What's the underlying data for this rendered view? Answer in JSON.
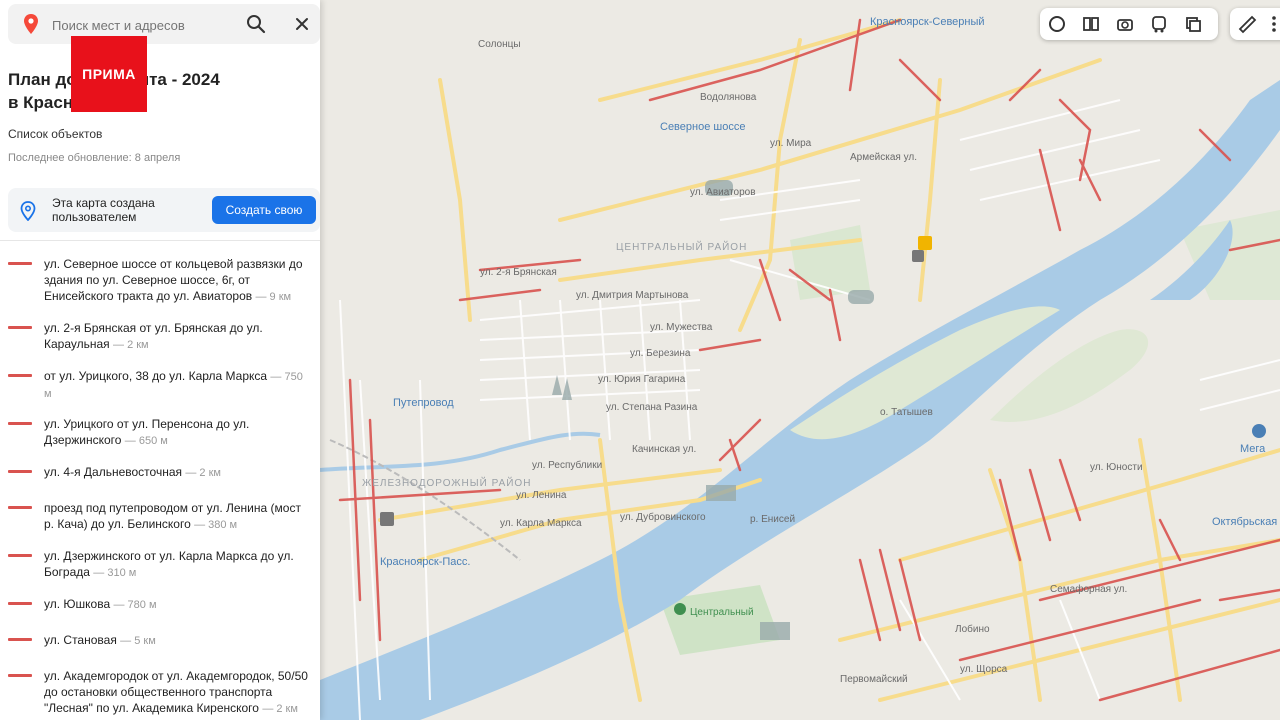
{
  "search": {
    "placeholder": "Поиск мест и адресов"
  },
  "logo": {
    "text": "ПРИМА"
  },
  "panel": {
    "title": "План дорожного ремонта - 2024 в Красноярске",
    "title_visible": "План до            о ремонта - 2024\nв Красн",
    "objects_link": "Список объектов",
    "updated": "Последнее обновление: 8 апреля",
    "promo_text": "Эта карта создана пользователем",
    "promo_button": "Создать свою"
  },
  "items": [
    {
      "name": "ул. Северное шоссе от кольцевой развязки до здания по ул. Северное шоссе, 6г, от Енисейского тракта до ул. Авиаторов",
      "length": "— 9 км"
    },
    {
      "name": "ул. 2-я Брянская от ул. Брянская до ул. Караульная",
      "length": "— 2 км"
    },
    {
      "name": "от ул. Урицкого, 38 до ул. Карла Маркса",
      "length": "— 750 м"
    },
    {
      "name": "ул. Урицкого от ул. Перенсона до ул. Дзержинского",
      "length": "— 650 м"
    },
    {
      "name": "ул. 4-я Дальневосточная",
      "length": "— 2 км"
    },
    {
      "name": "проезд под путепроводом от ул. Ленина (мост р. Кача) до ул. Белинского",
      "length": "— 380 м"
    },
    {
      "name": "ул. Дзержинского от ул. Карла Маркса до ул. Бограда",
      "length": "— 310 м"
    },
    {
      "name": "ул. Юшкова",
      "length": "— 780 м"
    },
    {
      "name": "ул. Становая",
      "length": "— 5 км"
    },
    {
      "name": "ул. Академгородок от ул. Академгородок, 50/50 до остановки общественного транспорта \"Лесная\" по ул. Академика Киренского",
      "length": "— 2 км"
    }
  ],
  "map": {
    "labels": {
      "solontsy": "Солонцы",
      "krasnoyarsk_north": "Красноярск-Северный",
      "vodolyanova": "Водолянова",
      "severnoe_shosse": "Северное шоссе",
      "tsentralny_rayon": "ЦЕНТРАЛЬНЫЙ РАЙОН",
      "zheleznodorozhny": "ЖЕЛЕЗНОДОРОЖНЫЙ РАЙОН",
      "putoprovod": "Путепровод",
      "krasnoyarsk_pass": "Красноярск-Пасс.",
      "tatyshev": "о. Татышев",
      "tsentralny_park": "Центральный",
      "yenisei": "р. Енисей",
      "mega": "Мега",
      "oktyabrskaya": "Октябрьская",
      "lobino": "Лобино",
      "pervomaysky": "Первомайский",
      "ul_lenina": "ул. Ленина",
      "ul_karla_marksa": "ул. Карла Маркса",
      "ul_respubliki": "ул. Республики",
      "ul_mira": "ул. Мира",
      "ul_aviatorov": "ул. Авиаторов",
      "ul_dm_martynova": "ул. Дмитрия Мартынова",
      "ul_muzhestva": "ул. Мужества",
      "ul_yuri_gagarina": "ул. Юрия Гагарина",
      "ul_stepana_razina": "ул. Степана Разина",
      "ul_2_bryanskaya": "ул. 2-я Брянская",
      "ul_kachinskaya": "Качинская ул.",
      "ul_dubrovinskogo": "ул. Дубровинского",
      "ul_armeyskaya": "Армейская ул.",
      "ul_berezina": "ул. Березина",
      "ul_yunosti": "ул. Юности",
      "ul_shchorsa": "ул. Щорса",
      "ul_semafornaya": "Семафорная ул."
    }
  },
  "colors": {
    "repair": "#d9534f",
    "water": "#a9cbe6",
    "road_major": "#f7dc8c",
    "accent": "#1a73e8",
    "brand": "#e8111b"
  }
}
